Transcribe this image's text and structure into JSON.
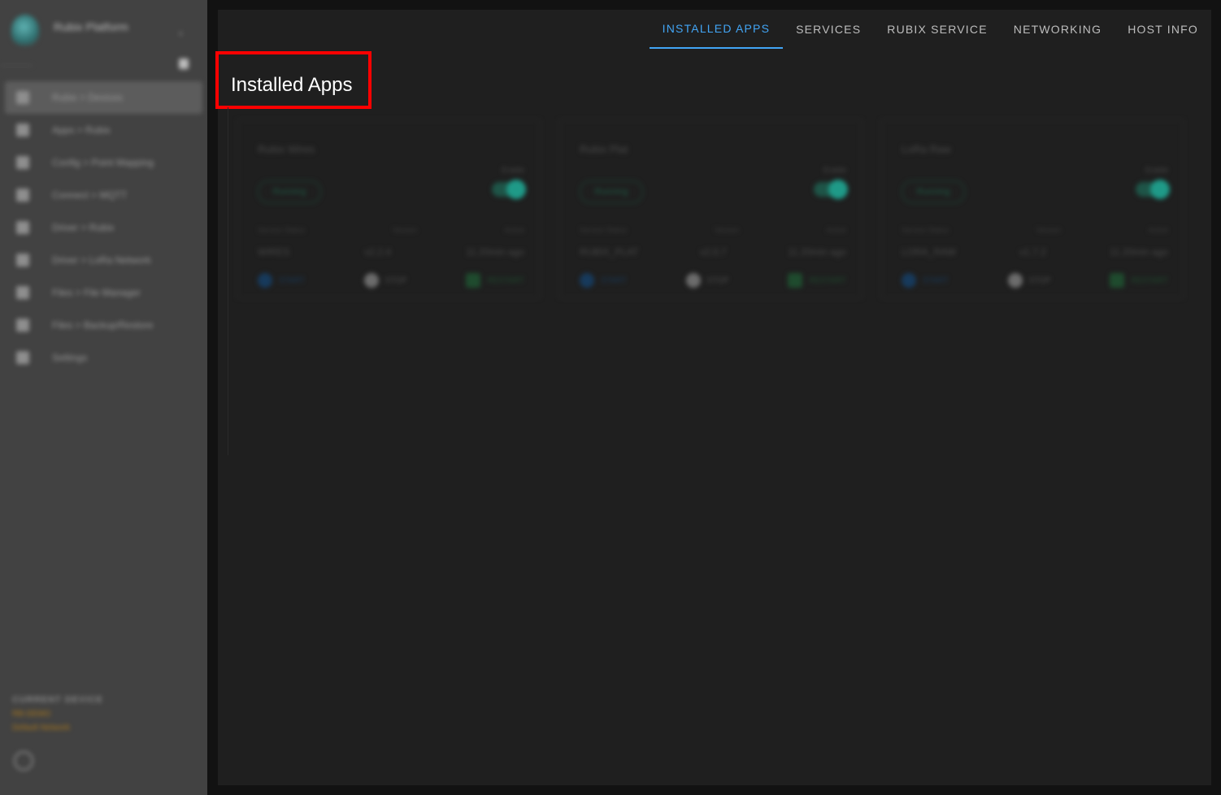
{
  "sidebar": {
    "brand": {
      "name": "Rubix Platform"
    },
    "nav": [
      {
        "label": "Rubix > Devices",
        "icon": "dashboard-icon",
        "active": true
      },
      {
        "label": "Apps > Rubix",
        "icon": "grid-icon"
      },
      {
        "label": "Config > Point Mapping",
        "icon": "mapping-icon"
      },
      {
        "label": "Connect > MQTT",
        "icon": "chart-icon"
      },
      {
        "label": "Driver > Rubix",
        "icon": "cloud-icon"
      },
      {
        "label": "Driver > LoRa Network",
        "icon": "network-icon"
      },
      {
        "label": "Files > File Manager",
        "icon": "file-icon"
      },
      {
        "label": "Files > Backup/Restore",
        "icon": "backup-icon"
      },
      {
        "label": "Settings",
        "icon": "gear-icon"
      }
    ],
    "current_device": {
      "heading": "CURRENT DEVICE",
      "name": "RB-DEMO",
      "sub": "Default Network"
    }
  },
  "tabs": [
    {
      "label": "INSTALLED APPS",
      "active": true
    },
    {
      "label": "SERVICES"
    },
    {
      "label": "RUBIX SERVICE"
    },
    {
      "label": "NETWORKING"
    },
    {
      "label": "HOST INFO"
    }
  ],
  "page": {
    "title": "Installed Apps"
  },
  "cards": [
    {
      "title": "Rubix Wires",
      "status": "Running",
      "enable_label": "Enable",
      "headers": {
        "service_status": "Service Status",
        "version": "Version",
        "active": "Active"
      },
      "values": {
        "service_status": "WIRES",
        "version": "v2.2.4",
        "active": "11.20min ago"
      },
      "actions": {
        "start": "START",
        "stop": "STOP",
        "restart": "RESTART"
      }
    },
    {
      "title": "Rubix Plat",
      "status": "Running",
      "enable_label": "Enable",
      "headers": {
        "service_status": "Service Status",
        "version": "Version",
        "active": "Active"
      },
      "values": {
        "service_status": "RUBIX_PLAT",
        "version": "v2.0.7",
        "active": "11.20min ago"
      },
      "actions": {
        "start": "START",
        "stop": "STOP",
        "restart": "RESTART"
      }
    },
    {
      "title": "LoRa Raw",
      "status": "Running",
      "enable_label": "Enable",
      "headers": {
        "service_status": "Service Status",
        "version": "Version",
        "active": "Active"
      },
      "values": {
        "service_status": "LORA_RAW",
        "version": "v1.7.2",
        "active": "11.20min ago"
      },
      "actions": {
        "start": "START",
        "stop": "STOP",
        "restart": "RESTART"
      }
    }
  ]
}
